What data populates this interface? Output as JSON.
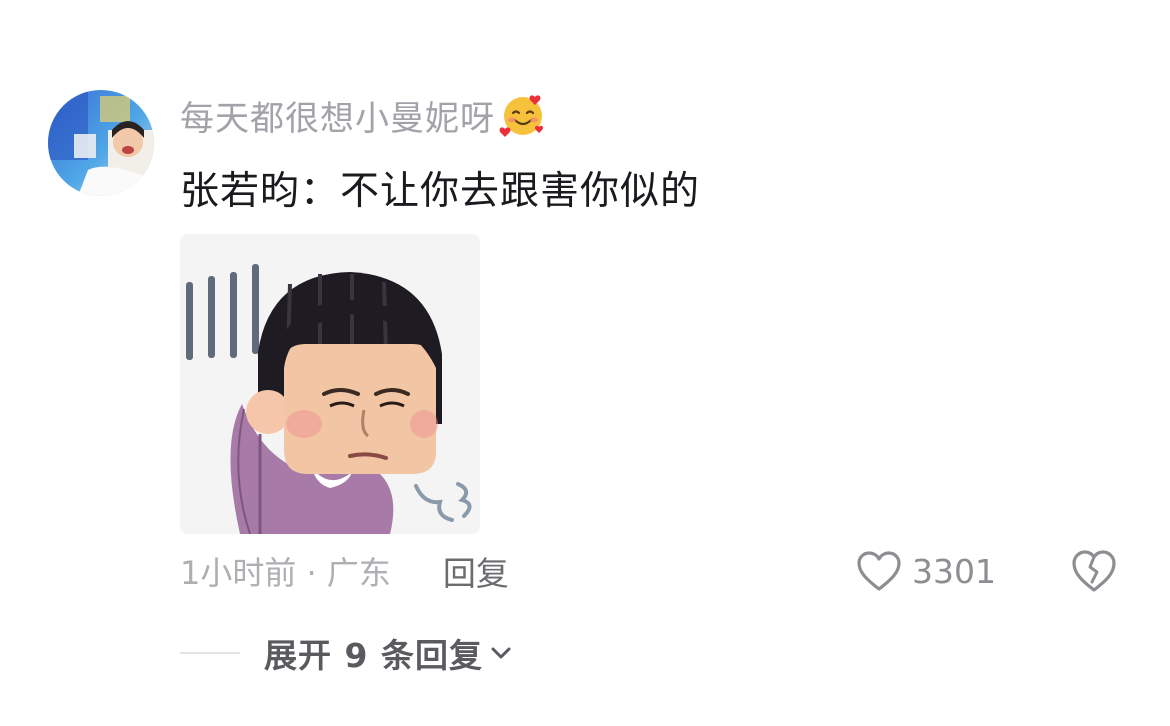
{
  "comment": {
    "username": "每天都很想小曼妮呀",
    "username_emoji": "smiling-face-with-hearts-icon",
    "text": "张若昀：不让你去跟害你似的",
    "time_location": "1小时前 · 广东",
    "reply_label": "回复",
    "like_count": "3301",
    "expand_label": "展开 9 条回复"
  },
  "colors": {
    "username": "#a2a2a8",
    "text": "#1b1b1f",
    "meta": "#aeaeb3",
    "reply": "#6b6b70",
    "like_count": "#8d8d92",
    "expand": "#5a5a5f"
  }
}
